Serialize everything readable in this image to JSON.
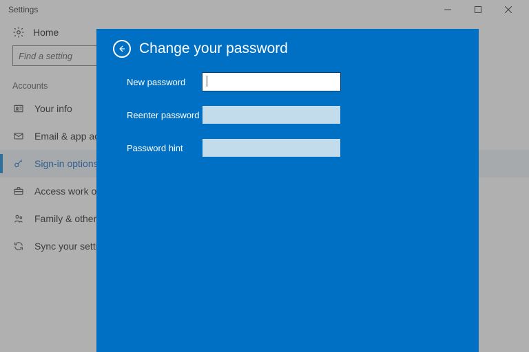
{
  "window": {
    "title": "Settings"
  },
  "home": {
    "label": "Home"
  },
  "search": {
    "placeholder": "Find a setting"
  },
  "section": {
    "label": "Accounts"
  },
  "nav": {
    "items": [
      {
        "icon": "person-badge-icon",
        "label": "Your info"
      },
      {
        "icon": "mail-icon",
        "label": "Email & app accounts"
      },
      {
        "icon": "key-icon",
        "label": "Sign-in options",
        "active": true
      },
      {
        "icon": "briefcase-icon",
        "label": "Access work or school"
      },
      {
        "icon": "family-icon",
        "label": "Family & other people"
      },
      {
        "icon": "sync-icon",
        "label": "Sync your settings"
      }
    ]
  },
  "panel": {
    "title": "Change your password",
    "fields": {
      "new_password": {
        "label": "New password",
        "value": ""
      },
      "reenter_password": {
        "label": "Reenter password",
        "value": ""
      },
      "password_hint": {
        "label": "Password hint",
        "value": ""
      }
    }
  }
}
